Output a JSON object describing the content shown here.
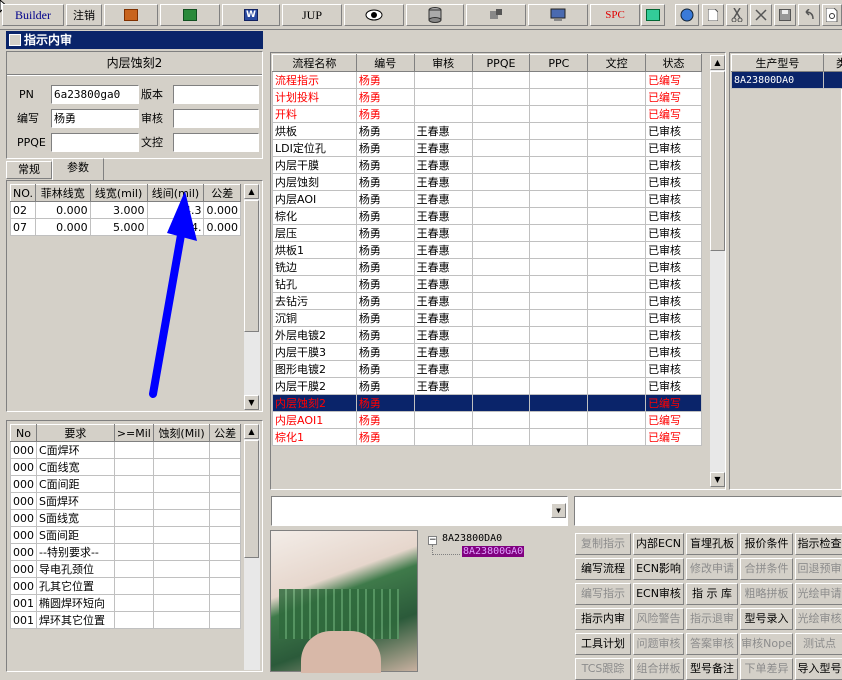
{
  "toolbar": {
    "builder": "Builder",
    "logout": "注销",
    "jup": "JUP",
    "spc": "SPC"
  },
  "window": {
    "title": "指示内审"
  },
  "left": {
    "step_name": "内层蚀刻2",
    "pn_label": "PN",
    "pn_value": "6a23800ga0",
    "version_label": "版本",
    "version_value": "",
    "editor_label": "编写",
    "editor_value": "杨勇",
    "review_label": "审核",
    "review_value": "",
    "ppqe_label": "PPQE",
    "ppqe_value": "",
    "wenkong_label": "文控",
    "wenkong_value": "",
    "tabs": [
      "常规",
      "参数"
    ],
    "param_headers": [
      "NO.",
      "菲林线宽",
      "线宽(mil)",
      "线间(mil)",
      "公差"
    ],
    "param_rows": [
      [
        "02",
        "0.000",
        "3.000",
        "4.3",
        "0.000"
      ],
      [
        "07",
        "0.000",
        "5.000",
        "4.",
        "0.000"
      ]
    ],
    "req_headers": [
      "No",
      "要求",
      ">=Mil",
      "蚀刻(Mil)",
      "公差"
    ],
    "req_rows": [
      [
        "000",
        "C面焊环"
      ],
      [
        "000",
        "C面线宽"
      ],
      [
        "000",
        "C面间距"
      ],
      [
        "000",
        "S面焊环"
      ],
      [
        "000",
        "S面线宽"
      ],
      [
        "000",
        "S面间距"
      ],
      [
        "000",
        "--特别要求--"
      ],
      [
        "000",
        "导电孔颈位"
      ],
      [
        "000",
        "孔其它位置"
      ],
      [
        "001",
        "椭圆焊环短向"
      ],
      [
        "001",
        "焊环其它位置"
      ]
    ]
  },
  "flow": {
    "headers": [
      "流程名称",
      "编号",
      "审核",
      "PPQE",
      "PPC",
      "文控",
      "状态"
    ],
    "rows": [
      {
        "name": "流程指示",
        "code": "杨勇",
        "review": "",
        "status": "已编写",
        "red": true
      },
      {
        "name": "计划投料",
        "code": "杨勇",
        "review": "",
        "status": "已编写",
        "red": true
      },
      {
        "name": "开料",
        "code": "杨勇",
        "review": "",
        "status": "已编写",
        "red": true
      },
      {
        "name": "烘板",
        "code": "杨勇",
        "review": "王春惠",
        "status": "已审核",
        "red": false
      },
      {
        "name": "LDI定位孔",
        "code": "杨勇",
        "review": "王春惠",
        "status": "已审核",
        "red": false
      },
      {
        "name": "内层干膜",
        "code": "杨勇",
        "review": "王春惠",
        "status": "已审核",
        "red": false
      },
      {
        "name": "内层蚀刻",
        "code": "杨勇",
        "review": "王春惠",
        "status": "已审核",
        "red": false
      },
      {
        "name": "内层AOI",
        "code": "杨勇",
        "review": "王春惠",
        "status": "已审核",
        "red": false
      },
      {
        "name": "棕化",
        "code": "杨勇",
        "review": "王春惠",
        "status": "已审核",
        "red": false
      },
      {
        "name": "层压",
        "code": "杨勇",
        "review": "王春惠",
        "status": "已审核",
        "red": false
      },
      {
        "name": "烘板1",
        "code": "杨勇",
        "review": "王春惠",
        "status": "已审核",
        "red": false
      },
      {
        "name": "铣边",
        "code": "杨勇",
        "review": "王春惠",
        "status": "已审核",
        "red": false
      },
      {
        "name": "钻孔",
        "code": "杨勇",
        "review": "王春惠",
        "status": "已审核",
        "red": false
      },
      {
        "name": "去钻污",
        "code": "杨勇",
        "review": "王春惠",
        "status": "已审核",
        "red": false
      },
      {
        "name": "沉铜",
        "code": "杨勇",
        "review": "王春惠",
        "status": "已审核",
        "red": false
      },
      {
        "name": "外层电镀2",
        "code": "杨勇",
        "review": "王春惠",
        "status": "已审核",
        "red": false
      },
      {
        "name": "内层干膜3",
        "code": "杨勇",
        "review": "王春惠",
        "status": "已审核",
        "red": false
      },
      {
        "name": "图形电镀2",
        "code": "杨勇",
        "review": "王春惠",
        "status": "已审核",
        "red": false
      },
      {
        "name": "内层干膜2",
        "code": "杨勇",
        "review": "王春惠",
        "status": "已审核",
        "red": false
      },
      {
        "name": "内层蚀刻2",
        "code": "杨勇",
        "review": "",
        "status": "已编写",
        "red": true,
        "selected": true
      },
      {
        "name": "内层AOI1",
        "code": "杨勇",
        "review": "",
        "status": "已编写",
        "red": true
      },
      {
        "name": "棕化1",
        "code": "杨勇",
        "review": "",
        "status": "已编写",
        "red": true
      }
    ]
  },
  "product": {
    "headers": [
      "生产型号",
      "类别"
    ],
    "rows": [
      [
        "8A23800DA0",
        ""
      ]
    ]
  },
  "tree": {
    "root": "8A23800DA0",
    "child": "8A23800GA0"
  },
  "buttons": [
    [
      "复制指示",
      "内部ECN",
      "盲埋孔板",
      "报价条件",
      "指示检查"
    ],
    [
      "编写流程",
      "ECN影响",
      "修改申请",
      "合拼条件",
      "回退预审"
    ],
    [
      "编写指示",
      "ECN审核",
      "指 示 库",
      "粗略拼板",
      "光绘申请"
    ],
    [
      "指示内审",
      "风险警告",
      "指示退审",
      "型号录入",
      "光绘审核"
    ],
    [
      "工具计划",
      "问题审核",
      "答案审核",
      "审核Nope",
      "测试点"
    ],
    [
      "TCS跟踪",
      "组合拼板",
      "型号备注",
      "下单差异",
      "导入型号"
    ]
  ],
  "buttons_disabled": [
    [
      true,
      false,
      false,
      false,
      false
    ],
    [
      false,
      false,
      true,
      true,
      true
    ],
    [
      true,
      false,
      false,
      true,
      true
    ],
    [
      false,
      true,
      true,
      false,
      true
    ],
    [
      false,
      true,
      true,
      true,
      true
    ],
    [
      true,
      true,
      false,
      true,
      false
    ]
  ],
  "colors": {
    "selection": "#0a246a",
    "status_red": "#ff0000",
    "arrow": "#0000ff",
    "tree_highlight": "#800080"
  }
}
